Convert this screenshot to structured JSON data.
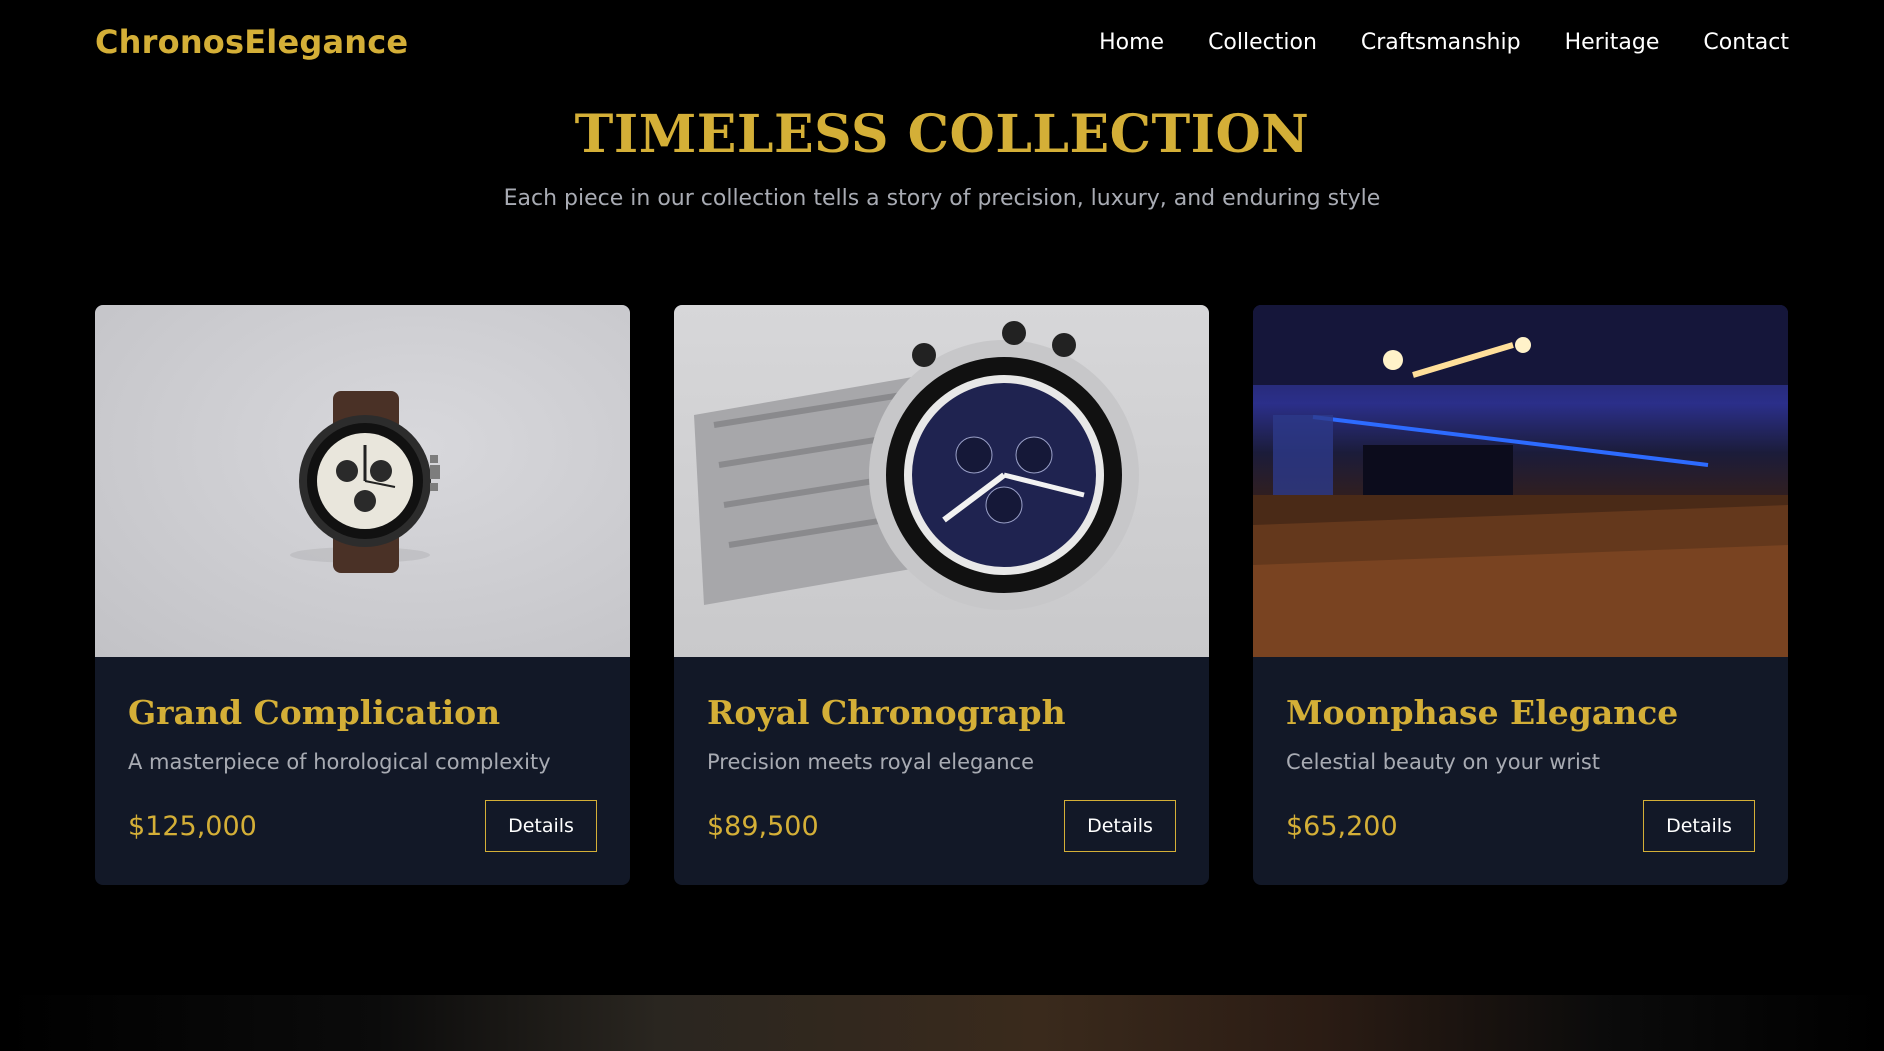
{
  "brand": {
    "name": "ChronosElegance"
  },
  "nav": {
    "items": [
      "Home",
      "Collection",
      "Craftsmanship",
      "Heritage",
      "Contact"
    ]
  },
  "hero": {
    "title": "TIMELESS COLLECTION",
    "subtitle": "Each piece in our collection tells a story of precision, luxury, and enduring style"
  },
  "products": [
    {
      "title": "Grand Complication",
      "description": "A masterpiece of horological complexity",
      "price": "$125,000",
      "button": "Details",
      "image": "watch-leather-strap-image"
    },
    {
      "title": "Royal Chronograph",
      "description": "Precision meets royal elegance",
      "price": "$89,500",
      "button": "Details",
      "image": "steel-chronograph-image"
    },
    {
      "title": "Moonphase Elegance",
      "description": "Celestial beauty on your wrist",
      "price": "$65,200",
      "button": "Details",
      "image": "concert-hall-image"
    }
  ],
  "theme": {
    "accent": "#d4af37",
    "background": "#000000",
    "card": "#121827",
    "muted": "#a8abb3"
  }
}
